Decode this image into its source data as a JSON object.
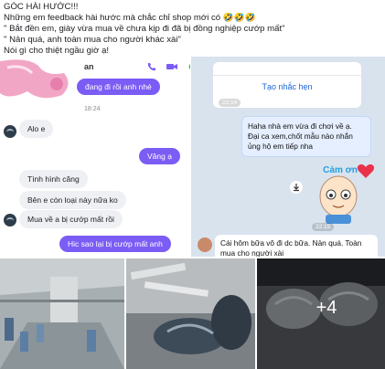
{
  "post": {
    "caption_lines": [
      "GÓC HÀI HƯỚC!!!",
      "Những em feedback hài hước mà chắc chỉ shop mới có 🤣🤣🤣",
      "\" Bắt đền em, giày vừa mua về chưa kịp đi đã bị đồng nghiệp cướp mất\"",
      "\" Nản quá, anh toàn mua cho người khác xài\"",
      "Nói gì cho thiệt ngầu giờ ạ!"
    ]
  },
  "left_chat": {
    "header_name": "an",
    "messages": {
      "m1": "đang đi rồi anh nhé",
      "time1": "18:24",
      "m2": "Alo e",
      "m3": "Vâng ạ",
      "m4": "Tình hình căng",
      "m5": "Bên e còn loại này nữa ko",
      "m6": "Mua về a bị cướp mất rồi",
      "m7": "Hic sao lại bị cướp mất anh"
    }
  },
  "right_chat": {
    "reminder_label": "Tạo nhắc hẹn",
    "time1": "22:14",
    "msg_out": "Haha nhà em vừa đi chơi về ạ. Đại ca xem,chốt mẫu nào nhắn ủng hộ em tiếp nha",
    "sticker_text": "Cảm ơn",
    "time2": "22:15",
    "msg_in": "Cái hôm bữa vô đi dc bữa. Nản quá. Toàn mua cho người xài"
  },
  "gallery": {
    "more_count": "+4"
  },
  "colors": {
    "purple": "#7b5cf5",
    "zalo_bg": "#d9e3ee",
    "zalo_blue": "#1a66d9"
  }
}
